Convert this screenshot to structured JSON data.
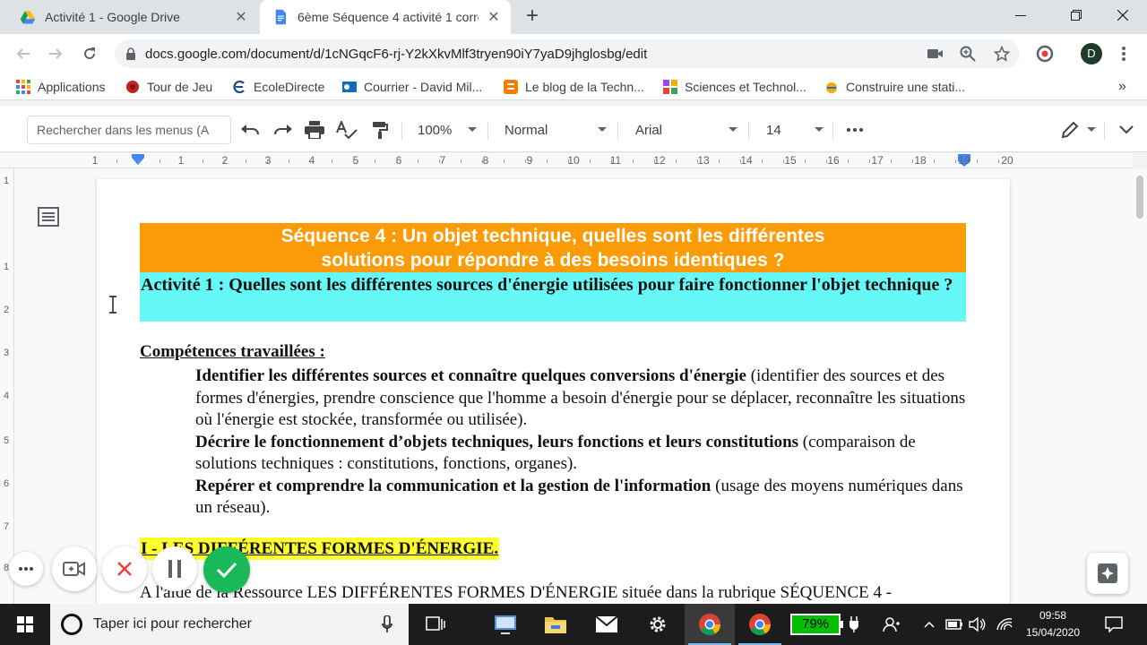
{
  "browser": {
    "tabs": [
      {
        "title": "Activité 1 - Google Drive",
        "icon": "google-drive-icon"
      },
      {
        "title": "6ème Séquence 4 activité 1 corre",
        "icon": "google-docs-icon"
      }
    ],
    "url": "docs.google.com/document/d/1cNGqcF6-rj-Y2kXkvMlf3tryen90iY7yaD9jhglosbg/edit",
    "avatar_letter": "D"
  },
  "bookmarks": [
    {
      "label": "Applications",
      "icon": "apps-grid-icon"
    },
    {
      "label": "Tour de Jeu",
      "icon": "red-star-icon"
    },
    {
      "label": "EcoleDirecte",
      "icon": "ecoledirecte-icon"
    },
    {
      "label": "Courrier - David Mil...",
      "icon": "outlook-icon"
    },
    {
      "label": "Le blog de la Techn...",
      "icon": "blogger-icon"
    },
    {
      "label": "Sciences et Technol...",
      "icon": "site-icon"
    },
    {
      "label": "Construire une stati...",
      "icon": "site-icon"
    }
  ],
  "docs_toolbar": {
    "menu_search_placeholder": "Rechercher dans les menus (A",
    "zoom": "100%",
    "style": "Normal",
    "font": "Arial",
    "font_size": "14"
  },
  "ruler": {
    "numbers": [
      "1",
      "1",
      "2",
      "3",
      "4",
      "5",
      "6",
      "7",
      "8",
      "9",
      "10",
      "11",
      "12",
      "13",
      "14",
      "15",
      "16",
      "17",
      "18",
      "19",
      "20"
    ]
  },
  "vruler": {
    "numbers": [
      "1",
      "1",
      "2",
      "3",
      "4",
      "5",
      "6",
      "7",
      "8"
    ]
  },
  "document": {
    "header_line1": "Séquence 4 : Un objet technique, quelles sont les différentes",
    "header_line2": "solutions pour répondre à des besoins identiques ?",
    "activity_title": "Activité 1 : Quelles sont les différentes sources d'énergie utilisées pour faire fonctionner l'objet technique ?",
    "competences_title": "Compétences travaillées :",
    "competences": [
      {
        "bold": "Identifier les différentes sources et connaître quelques conversions d'énergie",
        "rest": " (identifier des sources et des formes d'énergies, prendre conscience que l'homme a besoin d'énergie pour se déplacer, reconnaître les situations où l'énergie est stockée, transformée ou utilisée)."
      },
      {
        "bold": "Décrire le fonctionnement d’objets techniques, leurs fonctions et leurs constitutions",
        "rest": " (comparaison de solutions techniques : constitutions, fonctions, organes)."
      },
      {
        "bold": "Repérer et comprendre la communication et la gestion de l'information",
        "rest": " (usage des moyens numériques dans un réseau)."
      }
    ],
    "section_title": "I - LES DIFFÉRENTES FORMES D'ÉNERGIE.",
    "paragraph_start": "A l'aide de la Ressource LES DIFFÉRENTES FORMES D'ÉNERGIE située dans la rubrique SÉQUENCE 4 -"
  },
  "taskbar": {
    "search_placeholder": "Taper ici pour rechercher",
    "battery": "79%",
    "time": "09:58",
    "date": "15/04/2020"
  },
  "colors": {
    "orange_header": "#fb9b07",
    "cyan_header": "#65f8f7",
    "yellow_highlight": "#ffff2f",
    "record_ok": "#18b85b",
    "record_cancel": "#e94235"
  }
}
